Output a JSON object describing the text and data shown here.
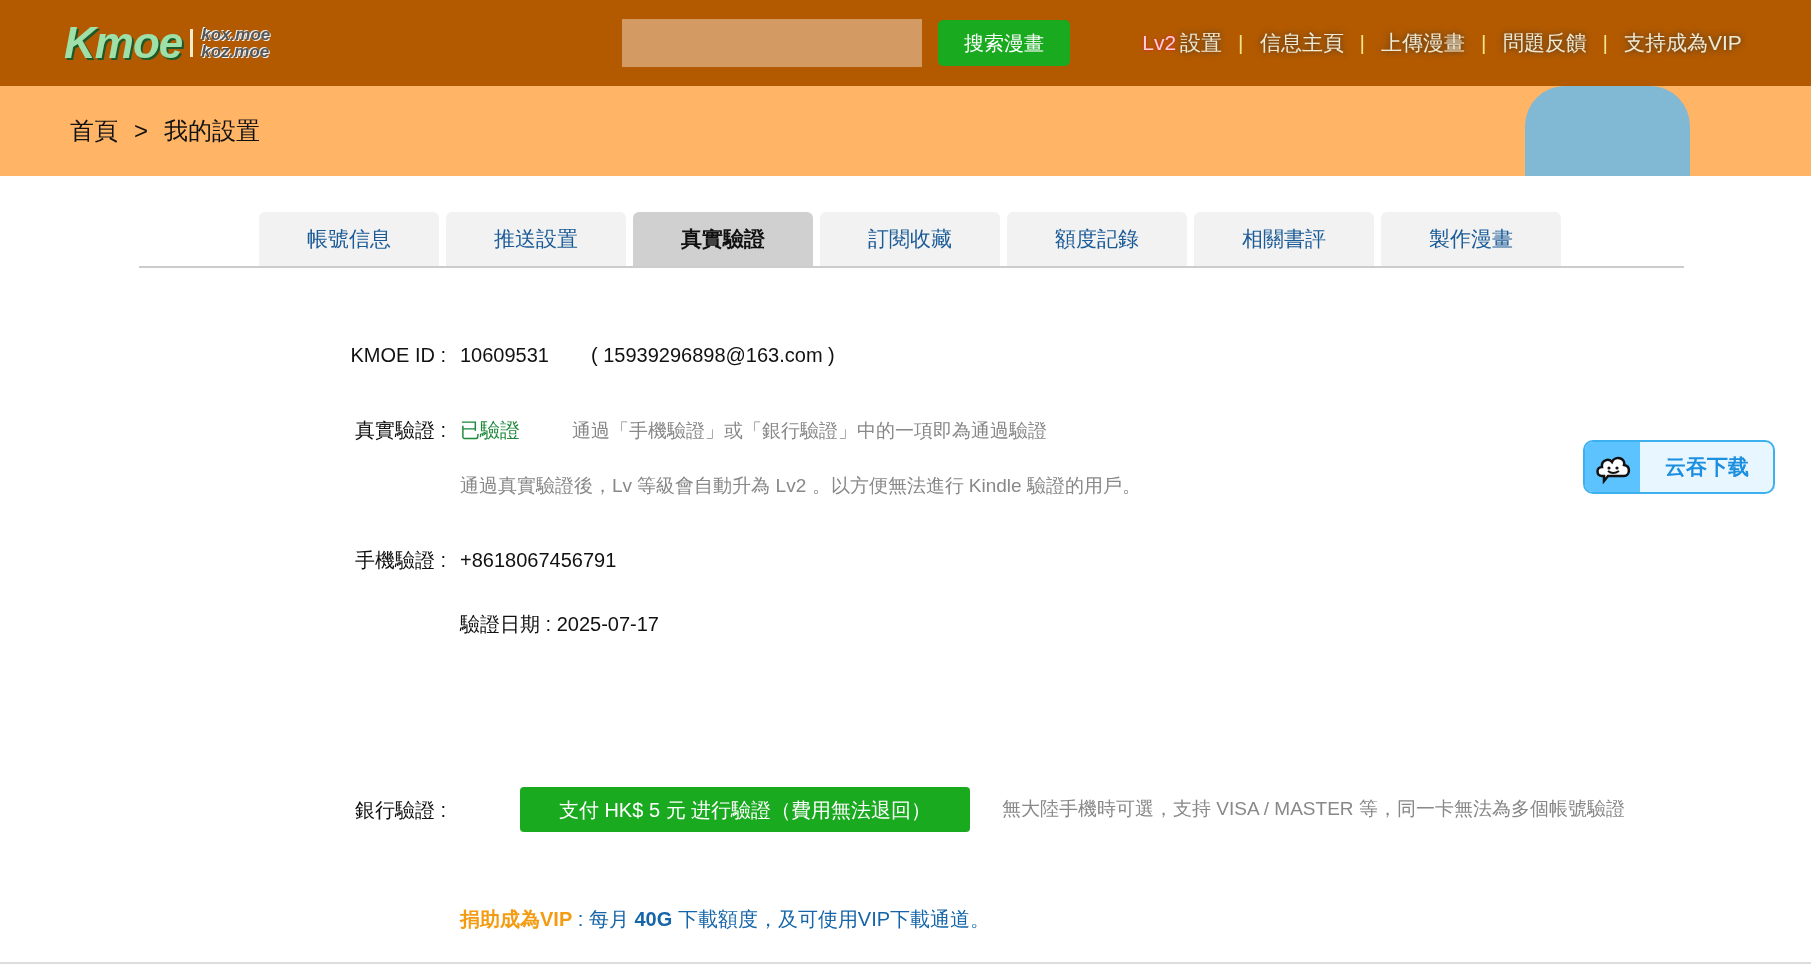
{
  "header": {
    "logo": "Kmoe",
    "domains": [
      "kox.moe",
      "koz.moe"
    ],
    "search_button": "搜索漫畫",
    "level_badge": "Lv2",
    "nav_separator": "|",
    "nav": [
      "設置",
      "信息主頁",
      "上傳漫畫",
      "問題反饋",
      "支持成為VIP"
    ]
  },
  "breadcrumb": {
    "items": [
      "首頁",
      "我的設置"
    ],
    "separator": ">"
  },
  "tabs": [
    {
      "label": "帳號信息",
      "selected": false
    },
    {
      "label": "推送設置",
      "selected": false
    },
    {
      "label": "真實驗證",
      "selected": true
    },
    {
      "label": "訂閱收藏",
      "selected": false
    },
    {
      "label": "額度記錄",
      "selected": false
    },
    {
      "label": "相關書評",
      "selected": false
    },
    {
      "label": "製作漫畫",
      "selected": false
    }
  ],
  "account": {
    "label": "KMOE ID :",
    "id": "10609531",
    "email": "( 15939296898@163.com )"
  },
  "real_verification": {
    "label": "真實驗證 :",
    "status": "已驗證",
    "verified": true,
    "hint": "通過「手機驗證」或「銀行驗證」中的一項即為通過驗證",
    "note": "通過真實驗證後，Lv 等級會自動升為 Lv2 。以方便無法進行 Kindle 驗證的用戶。"
  },
  "phone_verification": {
    "label": "手機驗證 :",
    "phone": "+8618067456791",
    "date": "驗證日期 : 2025-07-17"
  },
  "bank_verification": {
    "label": "銀行驗證 :",
    "button": "支付 HK$ 5 元 进行驗證（費用無法退回）",
    "hint": "無大陸手機時可選，支持 VISA / MASTER 等，同一卡無法為多個帳號驗證"
  },
  "vip_promo": "**捐助成為VIP** : 每月 **40G** 下載額度，及可使用VIP下載通道。",
  "floating_button": "云吞下载"
}
